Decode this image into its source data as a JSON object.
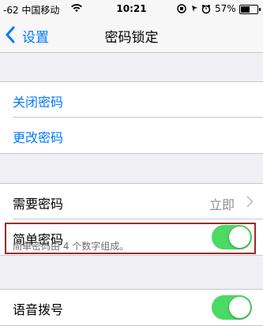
{
  "status_bar": {
    "carrier": "-62 中国移动",
    "time": "10:21",
    "battery": "57%",
    "battery_level": 0.57
  },
  "nav": {
    "back_label": "设置",
    "title": "密码锁定"
  },
  "group1": {
    "items": [
      {
        "label": "关闭密码"
      },
      {
        "label": "更改密码"
      }
    ]
  },
  "group2": {
    "require_label": "需要密码",
    "require_value": "立即",
    "simple_label": "简单密码",
    "simple_on": true,
    "footer": "简单密码由 4 个数字组成。"
  },
  "group3": {
    "voice_label": "语音拨号",
    "voice_on": true
  },
  "colors": {
    "accent": "#007aff",
    "toggle_on": "#4cd964",
    "highlight": "#9b2b2b"
  }
}
